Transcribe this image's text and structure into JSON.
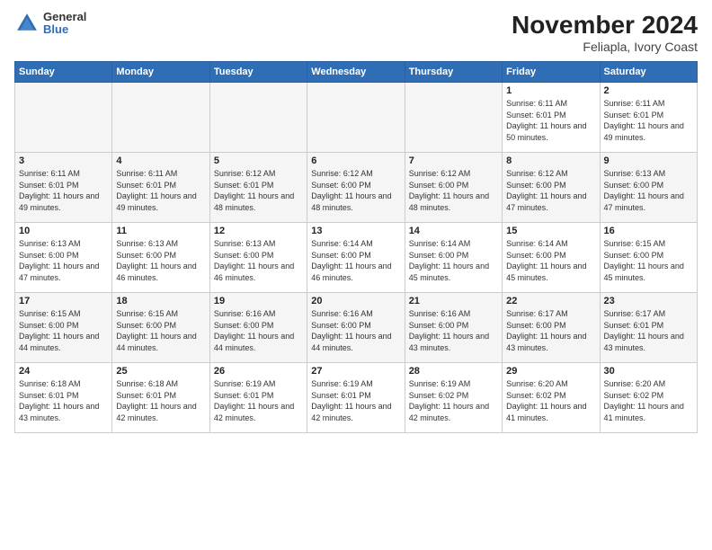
{
  "header": {
    "logo": {
      "general": "General",
      "blue": "Blue"
    },
    "title": "November 2024",
    "location": "Feliapla, Ivory Coast"
  },
  "weekdays": [
    "Sunday",
    "Monday",
    "Tuesday",
    "Wednesday",
    "Thursday",
    "Friday",
    "Saturday"
  ],
  "weeks": [
    [
      {
        "day": "",
        "sunrise": "",
        "sunset": "",
        "daylight": ""
      },
      {
        "day": "",
        "sunrise": "",
        "sunset": "",
        "daylight": ""
      },
      {
        "day": "",
        "sunrise": "",
        "sunset": "",
        "daylight": ""
      },
      {
        "day": "",
        "sunrise": "",
        "sunset": "",
        "daylight": ""
      },
      {
        "day": "",
        "sunrise": "",
        "sunset": "",
        "daylight": ""
      },
      {
        "day": "1",
        "sunrise": "Sunrise: 6:11 AM",
        "sunset": "Sunset: 6:01 PM",
        "daylight": "Daylight: 11 hours and 50 minutes."
      },
      {
        "day": "2",
        "sunrise": "Sunrise: 6:11 AM",
        "sunset": "Sunset: 6:01 PM",
        "daylight": "Daylight: 11 hours and 49 minutes."
      }
    ],
    [
      {
        "day": "3",
        "sunrise": "Sunrise: 6:11 AM",
        "sunset": "Sunset: 6:01 PM",
        "daylight": "Daylight: 11 hours and 49 minutes."
      },
      {
        "day": "4",
        "sunrise": "Sunrise: 6:11 AM",
        "sunset": "Sunset: 6:01 PM",
        "daylight": "Daylight: 11 hours and 49 minutes."
      },
      {
        "day": "5",
        "sunrise": "Sunrise: 6:12 AM",
        "sunset": "Sunset: 6:01 PM",
        "daylight": "Daylight: 11 hours and 48 minutes."
      },
      {
        "day": "6",
        "sunrise": "Sunrise: 6:12 AM",
        "sunset": "Sunset: 6:00 PM",
        "daylight": "Daylight: 11 hours and 48 minutes."
      },
      {
        "day": "7",
        "sunrise": "Sunrise: 6:12 AM",
        "sunset": "Sunset: 6:00 PM",
        "daylight": "Daylight: 11 hours and 48 minutes."
      },
      {
        "day": "8",
        "sunrise": "Sunrise: 6:12 AM",
        "sunset": "Sunset: 6:00 PM",
        "daylight": "Daylight: 11 hours and 47 minutes."
      },
      {
        "day": "9",
        "sunrise": "Sunrise: 6:13 AM",
        "sunset": "Sunset: 6:00 PM",
        "daylight": "Daylight: 11 hours and 47 minutes."
      }
    ],
    [
      {
        "day": "10",
        "sunrise": "Sunrise: 6:13 AM",
        "sunset": "Sunset: 6:00 PM",
        "daylight": "Daylight: 11 hours and 47 minutes."
      },
      {
        "day": "11",
        "sunrise": "Sunrise: 6:13 AM",
        "sunset": "Sunset: 6:00 PM",
        "daylight": "Daylight: 11 hours and 46 minutes."
      },
      {
        "day": "12",
        "sunrise": "Sunrise: 6:13 AM",
        "sunset": "Sunset: 6:00 PM",
        "daylight": "Daylight: 11 hours and 46 minutes."
      },
      {
        "day": "13",
        "sunrise": "Sunrise: 6:14 AM",
        "sunset": "Sunset: 6:00 PM",
        "daylight": "Daylight: 11 hours and 46 minutes."
      },
      {
        "day": "14",
        "sunrise": "Sunrise: 6:14 AM",
        "sunset": "Sunset: 6:00 PM",
        "daylight": "Daylight: 11 hours and 45 minutes."
      },
      {
        "day": "15",
        "sunrise": "Sunrise: 6:14 AM",
        "sunset": "Sunset: 6:00 PM",
        "daylight": "Daylight: 11 hours and 45 minutes."
      },
      {
        "day": "16",
        "sunrise": "Sunrise: 6:15 AM",
        "sunset": "Sunset: 6:00 PM",
        "daylight": "Daylight: 11 hours and 45 minutes."
      }
    ],
    [
      {
        "day": "17",
        "sunrise": "Sunrise: 6:15 AM",
        "sunset": "Sunset: 6:00 PM",
        "daylight": "Daylight: 11 hours and 44 minutes."
      },
      {
        "day": "18",
        "sunrise": "Sunrise: 6:15 AM",
        "sunset": "Sunset: 6:00 PM",
        "daylight": "Daylight: 11 hours and 44 minutes."
      },
      {
        "day": "19",
        "sunrise": "Sunrise: 6:16 AM",
        "sunset": "Sunset: 6:00 PM",
        "daylight": "Daylight: 11 hours and 44 minutes."
      },
      {
        "day": "20",
        "sunrise": "Sunrise: 6:16 AM",
        "sunset": "Sunset: 6:00 PM",
        "daylight": "Daylight: 11 hours and 44 minutes."
      },
      {
        "day": "21",
        "sunrise": "Sunrise: 6:16 AM",
        "sunset": "Sunset: 6:00 PM",
        "daylight": "Daylight: 11 hours and 43 minutes."
      },
      {
        "day": "22",
        "sunrise": "Sunrise: 6:17 AM",
        "sunset": "Sunset: 6:00 PM",
        "daylight": "Daylight: 11 hours and 43 minutes."
      },
      {
        "day": "23",
        "sunrise": "Sunrise: 6:17 AM",
        "sunset": "Sunset: 6:01 PM",
        "daylight": "Daylight: 11 hours and 43 minutes."
      }
    ],
    [
      {
        "day": "24",
        "sunrise": "Sunrise: 6:18 AM",
        "sunset": "Sunset: 6:01 PM",
        "daylight": "Daylight: 11 hours and 43 minutes."
      },
      {
        "day": "25",
        "sunrise": "Sunrise: 6:18 AM",
        "sunset": "Sunset: 6:01 PM",
        "daylight": "Daylight: 11 hours and 42 minutes."
      },
      {
        "day": "26",
        "sunrise": "Sunrise: 6:19 AM",
        "sunset": "Sunset: 6:01 PM",
        "daylight": "Daylight: 11 hours and 42 minutes."
      },
      {
        "day": "27",
        "sunrise": "Sunrise: 6:19 AM",
        "sunset": "Sunset: 6:01 PM",
        "daylight": "Daylight: 11 hours and 42 minutes."
      },
      {
        "day": "28",
        "sunrise": "Sunrise: 6:19 AM",
        "sunset": "Sunset: 6:02 PM",
        "daylight": "Daylight: 11 hours and 42 minutes."
      },
      {
        "day": "29",
        "sunrise": "Sunrise: 6:20 AM",
        "sunset": "Sunset: 6:02 PM",
        "daylight": "Daylight: 11 hours and 41 minutes."
      },
      {
        "day": "30",
        "sunrise": "Sunrise: 6:20 AM",
        "sunset": "Sunset: 6:02 PM",
        "daylight": "Daylight: 11 hours and 41 minutes."
      }
    ]
  ]
}
